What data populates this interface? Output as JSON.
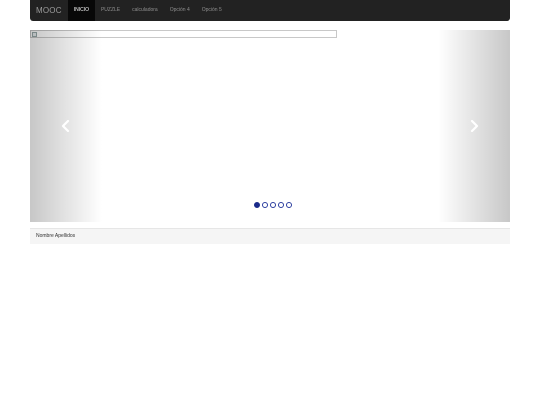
{
  "navbar": {
    "brand": "MOOC",
    "items": [
      {
        "label": "INICIO",
        "active": true
      },
      {
        "label": "PUZZLE",
        "active": false
      },
      {
        "label": "calculadora",
        "active": false
      },
      {
        "label": "Opción 4",
        "active": false
      },
      {
        "label": "Opción 5",
        "active": false
      }
    ]
  },
  "carousel": {
    "slide_count": 5,
    "active_index": 0,
    "prev_icon": "chevron-left-icon",
    "next_icon": "chevron-right-icon",
    "indicator_color": "#1a2a8a"
  },
  "footer": {
    "text": "Nombre Apellidos"
  }
}
